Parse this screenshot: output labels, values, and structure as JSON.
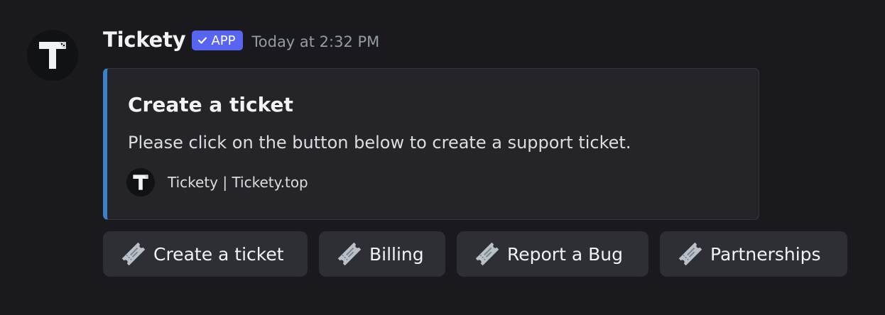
{
  "bot": {
    "name": "Tickety",
    "badge": "APP",
    "timestamp": "Today at 2:32 PM",
    "avatar_letter": "T"
  },
  "embed": {
    "accent_color": "#3d7fc9",
    "title": "Create a ticket",
    "description": "Please click on the button below to create a support ticket.",
    "footer_text": "Tickety | Tickety.top"
  },
  "buttons": [
    {
      "label": "Create a ticket",
      "icon": "ticket-icon"
    },
    {
      "label": "Billing",
      "icon": "ticket-icon"
    },
    {
      "label": "Report a Bug",
      "icon": "ticket-icon"
    },
    {
      "label": "Partnerships",
      "icon": "ticket-icon"
    }
  ],
  "colors": {
    "background": "#1a1a1e",
    "badge": "#5865f2",
    "button": "#2e2f35"
  }
}
